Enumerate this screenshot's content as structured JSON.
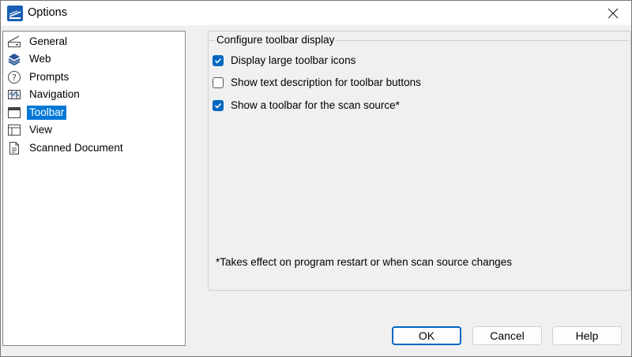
{
  "window": {
    "title": "Options",
    "close_glyph": "✕"
  },
  "nav": {
    "items": [
      {
        "label": "General",
        "icon": "scanner-icon"
      },
      {
        "label": "Web",
        "icon": "layers-icon"
      },
      {
        "label": "Prompts",
        "icon": "question-icon"
      },
      {
        "label": "Navigation",
        "icon": "map-icon"
      },
      {
        "label": "Toolbar",
        "icon": "toolbar-icon",
        "selected": true
      },
      {
        "label": "View",
        "icon": "view-icon"
      },
      {
        "label": "Scanned Document",
        "icon": "document-icon"
      }
    ]
  },
  "group": {
    "title": "Configure toolbar display",
    "options": [
      {
        "label": "Display large toolbar icons",
        "checked": true
      },
      {
        "label": "Show text description for toolbar buttons",
        "checked": false
      },
      {
        "label": "Show a toolbar for the scan source*",
        "checked": true
      }
    ],
    "note": "*Takes effect on program restart or when scan source changes"
  },
  "buttons": {
    "ok": "OK",
    "cancel": "Cancel",
    "help": "Help"
  },
  "colors": {
    "accent": "#0067c0",
    "selection": "#0078d7"
  }
}
